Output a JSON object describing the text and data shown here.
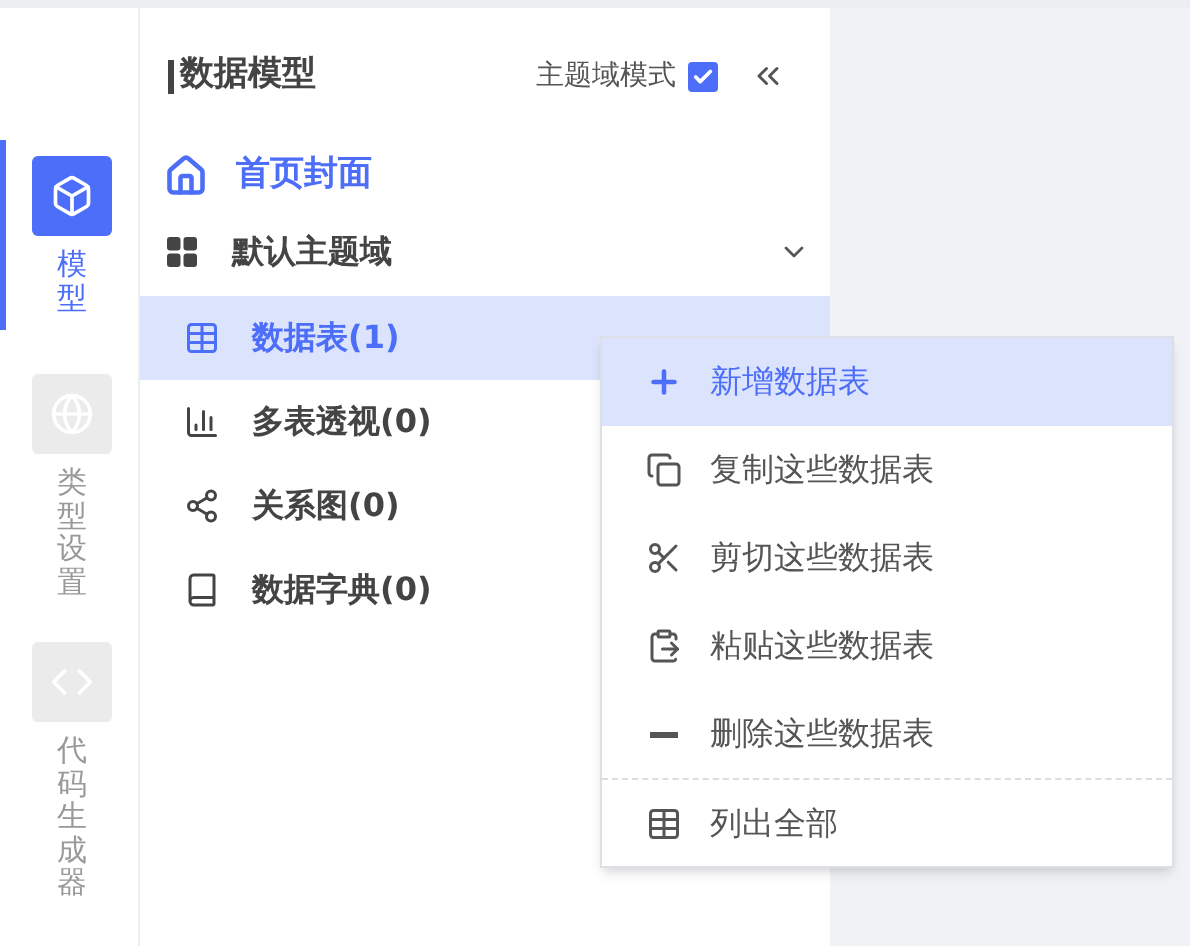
{
  "rail": [
    {
      "label": "模型",
      "selected": true
    },
    {
      "label": "类型设置",
      "selected": false
    },
    {
      "label": "代码生成器",
      "selected": false
    }
  ],
  "panel": {
    "title": "数据模型",
    "mode_label": "主题域模式",
    "mode_checked": true
  },
  "home": {
    "label": "首页封面"
  },
  "domain": {
    "label": "默认主题域",
    "expanded": true,
    "children": [
      {
        "label": "数据表(1)",
        "selected": true
      },
      {
        "label": "多表透视(0)",
        "selected": false
      },
      {
        "label": "关系图(0)",
        "selected": false
      },
      {
        "label": "数据字典(0)",
        "selected": false
      }
    ]
  },
  "context_menu": [
    {
      "label": "新增数据表",
      "selected": true,
      "separated": false
    },
    {
      "label": "复制这些数据表",
      "selected": false,
      "separated": false
    },
    {
      "label": "剪切这些数据表",
      "selected": false,
      "separated": false
    },
    {
      "label": "粘贴这些数据表",
      "selected": false,
      "separated": false
    },
    {
      "label": "删除这些数据表",
      "selected": false,
      "separated": false
    },
    {
      "label": "列出全部",
      "selected": false,
      "separated": true
    }
  ]
}
